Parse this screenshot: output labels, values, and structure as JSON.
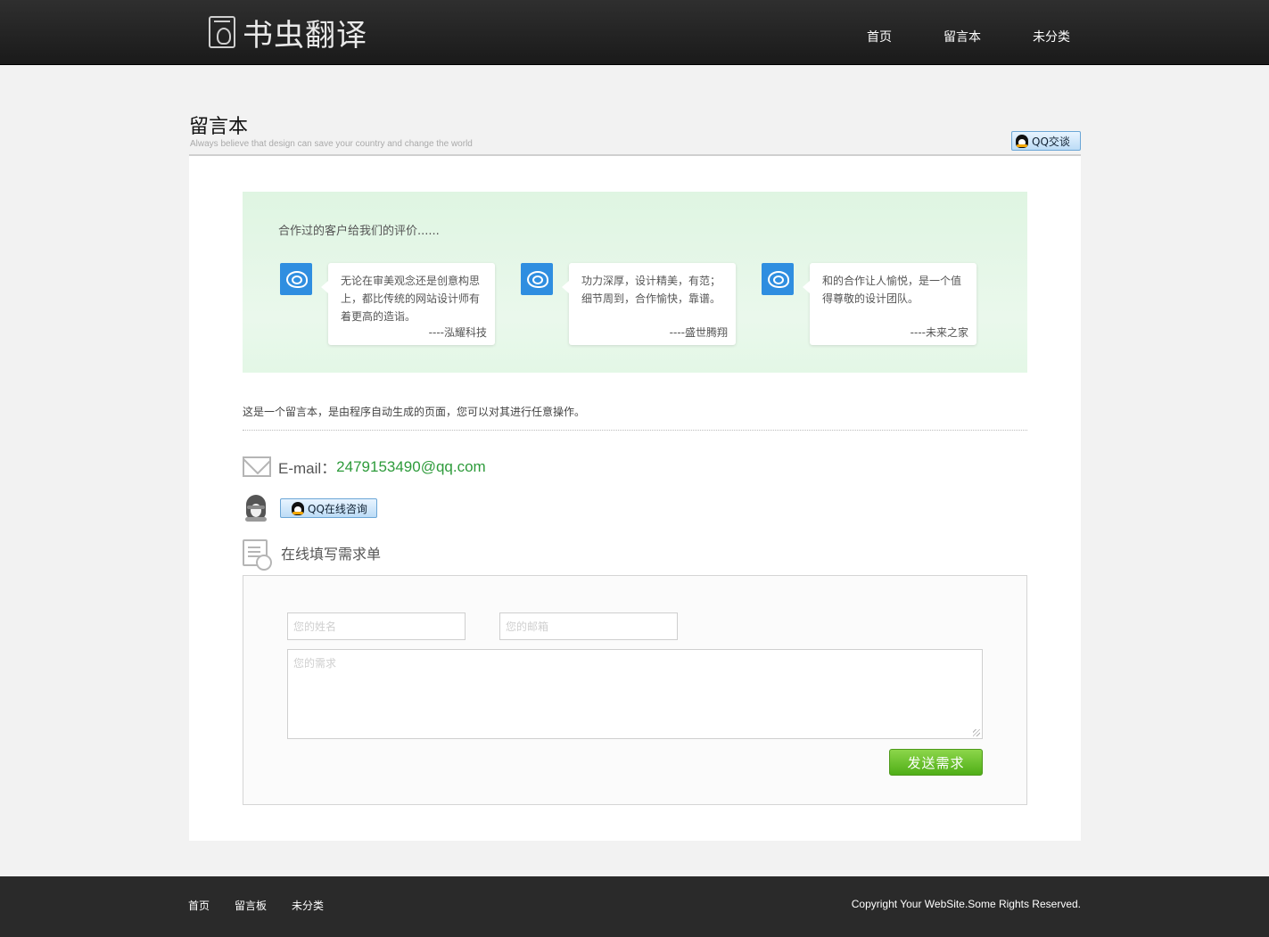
{
  "header": {
    "logo_text": "书虫翻译",
    "nav": [
      "首页",
      "留言本",
      "未分类"
    ]
  },
  "page": {
    "title": "留言本",
    "subtitle": "Always believe that design can save your country and change the world",
    "qq_talk_label": "QQ交谈"
  },
  "testimonials": {
    "title": "合作过的客户给我们的评价......",
    "items": [
      {
        "text": "无论在审美观念还是创意构思上，都比传统的网站设计师有着更高的造诣。",
        "author": "----泓耀科技"
      },
      {
        "text": "功力深厚，设计精美，有范；细节周到，合作愉快，靠谱。",
        "author": "----盛世腾翔"
      },
      {
        "text": "和的合作让人愉悦，是一个值得尊敬的设计团队。",
        "author": "----未来之家"
      }
    ]
  },
  "description": "这是一个留言本，是由程序自动生成的页面，您可以对其进行任意操作。",
  "contact": {
    "email_label": "E-mail：",
    "email": "2479153490@qq.com",
    "qq_consult_label": "QQ在线咨询"
  },
  "form": {
    "title": "在线填写需求单",
    "name_placeholder": "您的姓名",
    "email_placeholder": "您的邮箱",
    "need_placeholder": "您的需求",
    "submit_label": "发送需求"
  },
  "footer": {
    "links": [
      "首页",
      "留言板",
      "未分类"
    ],
    "copyright": "Copyright Your WebSite.Some Rights Reserved."
  },
  "colors": {
    "header_bg": "#1f1f1f",
    "email_green": "#2e9b3b",
    "button_green": "#5cb91f",
    "testimonial_bg": "#e2f6e5"
  }
}
